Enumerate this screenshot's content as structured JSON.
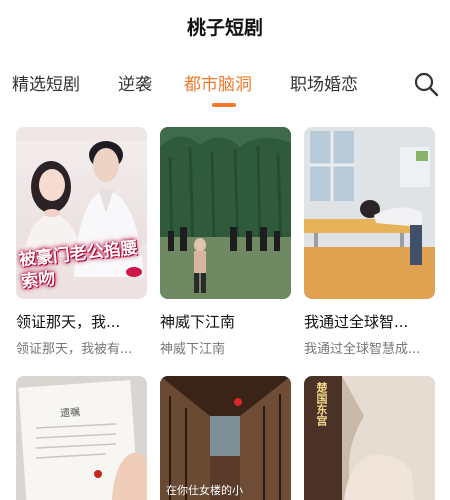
{
  "app": {
    "title": "桃子短剧"
  },
  "tabs": [
    {
      "label": "精选短剧",
      "active": false
    },
    {
      "label": "逆袭",
      "active": false
    },
    {
      "label": "都市脑洞",
      "active": true
    },
    {
      "label": "职场婚恋",
      "active": false
    }
  ],
  "search": {
    "icon": "search-icon"
  },
  "accent_color": "#f07a2a",
  "dramas": [
    {
      "title": "领证那天，我...",
      "subtitle": "领证那天，我被有...",
      "poster_text": "被豪门老公掐腰索吻"
    },
    {
      "title": "神威下江南",
      "subtitle": "神威下江南"
    },
    {
      "title": "我通过全球智...",
      "subtitle": "我通过全球智慧成..."
    },
    {
      "title": "",
      "subtitle": "",
      "poster_text": "遗嘱"
    },
    {
      "title": "",
      "subtitle": "",
      "poster_text": "在你仕女楼的小"
    },
    {
      "title": "",
      "subtitle": "",
      "poster_text": "楚国东宫"
    }
  ]
}
